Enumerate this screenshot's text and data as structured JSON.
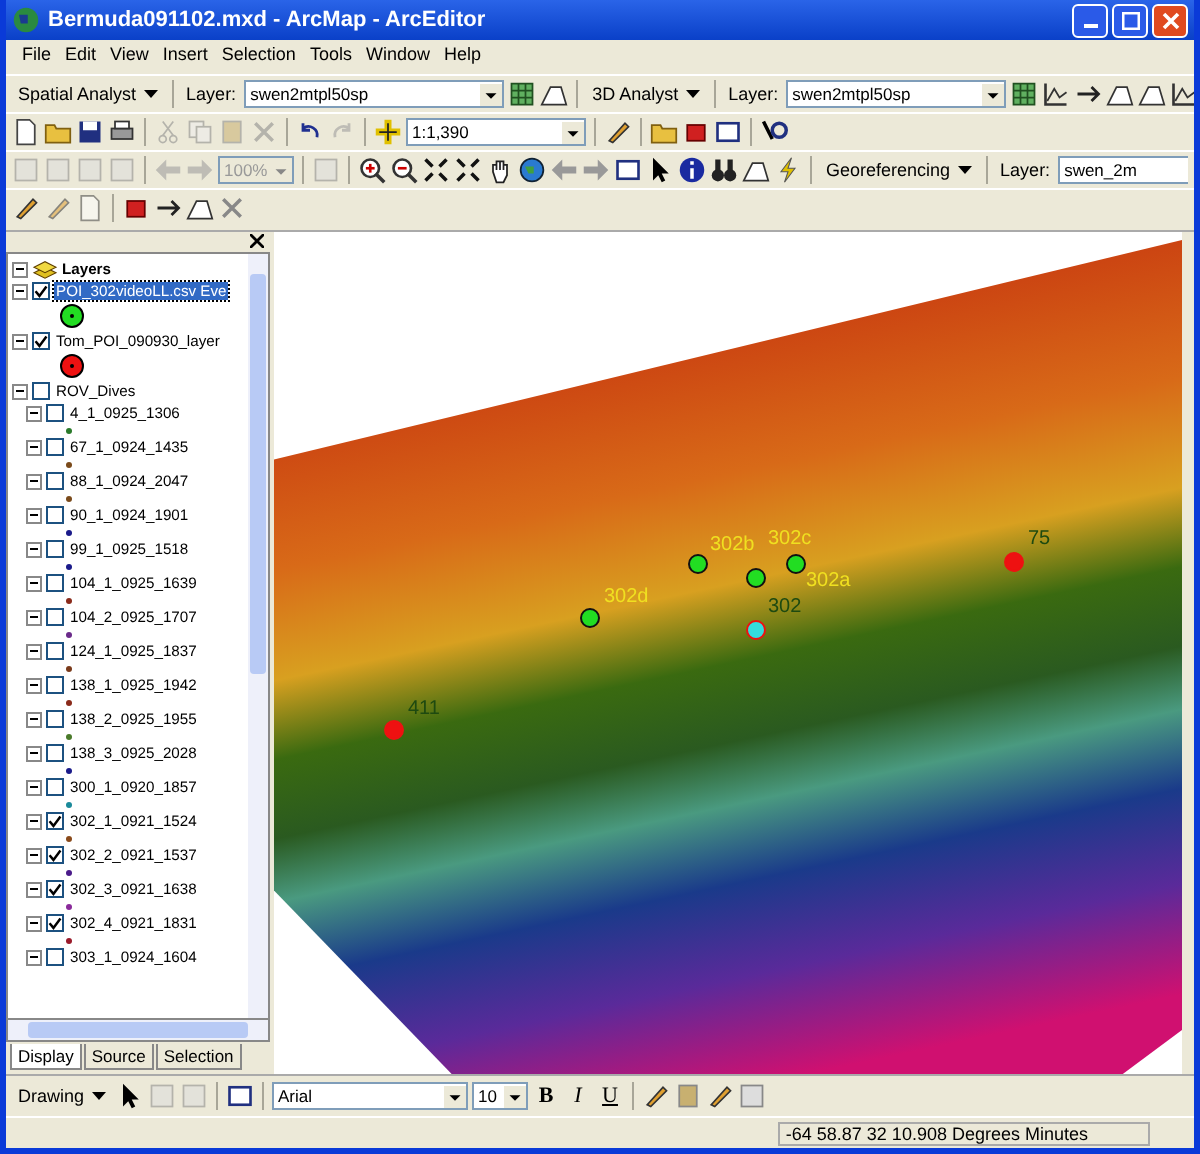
{
  "window": {
    "title": "Bermuda091102.mxd - ArcMap - ArcEditor"
  },
  "menu": [
    "File",
    "Edit",
    "View",
    "Insert",
    "Selection",
    "Tools",
    "Window",
    "Help"
  ],
  "spatial_analyst_toolbar": {
    "menu": "Spatial Analyst",
    "layer_label": "Layer:",
    "layer": "swen2mtpl50sp"
  },
  "analyst_3d_toolbar": {
    "menu": "3D Analyst",
    "layer_label": "Layer:",
    "layer": "swen2mtpl50sp"
  },
  "standard_toolbar": {
    "scale": "1:1,390"
  },
  "layout_toolbar": {
    "zoom": "100%",
    "zoom_disabled": true
  },
  "georeferencing_toolbar": {
    "menu": "Georeferencing",
    "layer_label": "Layer:",
    "layer": "swen_2m"
  },
  "toc": {
    "root": "Layers",
    "layers": [
      {
        "name": "POI_302videoLL.csv Eve",
        "checked": true,
        "selected": true,
        "color": "#22dd22"
      },
      {
        "name": "Tom_POI_090930_layer",
        "checked": true,
        "selected": false,
        "color": "#ee1111"
      },
      {
        "name": "ROV_Dives",
        "checked": false,
        "selected": false,
        "children": [
          {
            "name": "4_1_0925_1306",
            "checked": false,
            "selected": false,
            "color": "#2a7a2a"
          },
          {
            "name": "67_1_0924_1435",
            "checked": false,
            "selected": false,
            "color": "#7a4a1a"
          },
          {
            "name": "88_1_0924_2047",
            "checked": false,
            "selected": false,
            "color": "#7a4a1a"
          },
          {
            "name": "90_1_0924_1901",
            "checked": false,
            "selected": false,
            "color": "#1a1a8a"
          },
          {
            "name": "99_1_0925_1518",
            "checked": false,
            "selected": false,
            "color": "#1a1a8a"
          },
          {
            "name": "104_1_0925_1639",
            "checked": false,
            "selected": false,
            "color": "#8a2a1a"
          },
          {
            "name": "104_2_0925_1707",
            "checked": false,
            "selected": false,
            "color": "#6a2a8a"
          },
          {
            "name": "124_1_0925_1837",
            "checked": false,
            "selected": false,
            "color": "#7a3a1a"
          },
          {
            "name": "138_1_0925_1942",
            "checked": false,
            "selected": false,
            "color": "#8a2a1a"
          },
          {
            "name": "138_2_0925_1955",
            "checked": false,
            "selected": false,
            "color": "#4a7a2a"
          },
          {
            "name": "138_3_0925_2028",
            "checked": false,
            "selected": false,
            "color": "#1a1a8a"
          },
          {
            "name": "300_1_0920_1857",
            "checked": false,
            "selected": false,
            "color": "#1a8a9a"
          },
          {
            "name": "302_1_0921_1524",
            "checked": true,
            "selected": false,
            "color": "#8a4a1a"
          },
          {
            "name": "302_2_0921_1537",
            "checked": true,
            "selected": false,
            "color": "#4a1a8a"
          },
          {
            "name": "302_3_0921_1638",
            "checked": true,
            "selected": false,
            "color": "#8a2a9a"
          },
          {
            "name": "302_4_0921_1831",
            "checked": true,
            "selected": false,
            "color": "#9a1a2a"
          },
          {
            "name": "303_1_0924_1604",
            "checked": false,
            "selected": false
          }
        ]
      }
    ],
    "tabs": [
      {
        "label": "Display",
        "selected": true
      },
      {
        "label": "Source",
        "selected": false
      },
      {
        "label": "Selection",
        "selected": false
      }
    ]
  },
  "map": {
    "points": [
      {
        "label": "302b",
        "color": "#22dd22",
        "kind": "video"
      },
      {
        "label": "302c",
        "color": "#22dd22",
        "kind": "video"
      },
      {
        "label": "302a",
        "color": "#22dd22",
        "kind": "video"
      },
      {
        "label": "302d",
        "color": "#22dd22",
        "kind": "video"
      },
      {
        "label": "302",
        "color": "#33dddd",
        "kind": "dive"
      },
      {
        "label": "75",
        "color": "#ee1111",
        "kind": "dive"
      },
      {
        "label": "411",
        "color": "#ee1111",
        "kind": "dive"
      }
    ]
  },
  "drawing_toolbar": {
    "menu": "Drawing",
    "font": "Arial",
    "size": "10",
    "bold": "B",
    "italic": "I",
    "underline": "U"
  },
  "status_bar": {
    "coordinates": "-64 58.87  32 10.908  Degrees Minutes"
  }
}
